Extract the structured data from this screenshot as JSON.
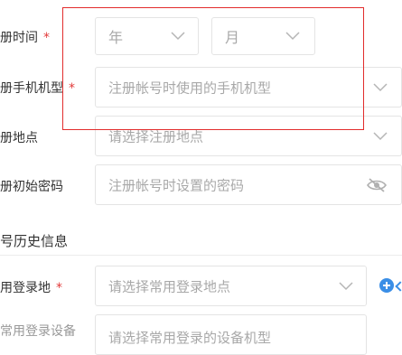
{
  "form": {
    "reg_time": {
      "label": "册时间",
      "required": "*",
      "year_placeholder": "年",
      "month_placeholder": "月"
    },
    "reg_phone": {
      "label": "册手机机型",
      "required": "*",
      "placeholder": "注册帐号时使用的手机机型"
    },
    "reg_place": {
      "label": "册地点",
      "placeholder": "请选择注册地点"
    },
    "reg_password": {
      "label": "册初始密码",
      "placeholder": "注册帐号时设置的密码"
    },
    "history_section_title": "号历史信息",
    "common_login": {
      "label": "用登录地",
      "required": "*",
      "placeholder": "请选择常用登录地点"
    },
    "next_row": {
      "label": "常用登录设备",
      "placeholder": "请选择常用登录的设备机型"
    }
  },
  "colors": {
    "annotation": "#e22c2c",
    "required": "#e23a3a",
    "placeholder": "#a8a8a8",
    "add_icon": "#3a8ee6"
  },
  "icons": [
    "chevron-down-icon",
    "eye-off-icon",
    "plus-circle-icon"
  ]
}
